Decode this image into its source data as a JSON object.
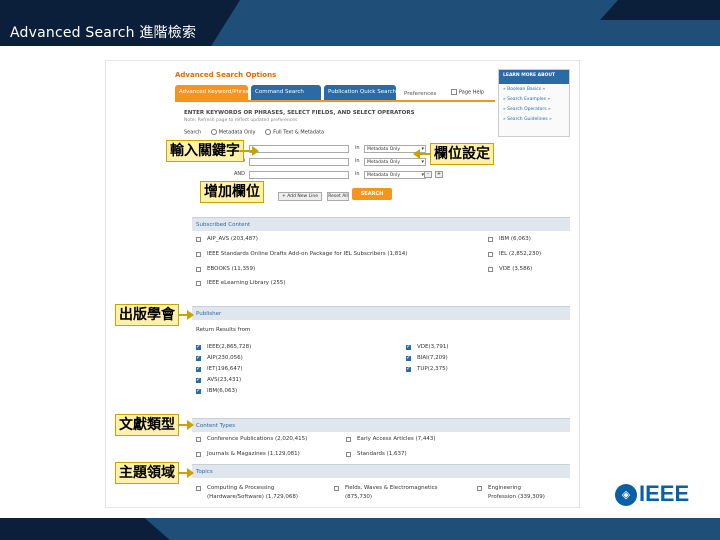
{
  "slide": {
    "title": "Advanced Search 進階檢索"
  },
  "colors": {
    "header": "#1f4e79",
    "accent_orange": "#f7941d",
    "ieee_blue": "#0b5fa5",
    "callout_bg": "#fff2a8"
  },
  "page": {
    "title": "Advanced Search Options",
    "tabs": [
      "Advanced Keyword/Phrases",
      "Command Search",
      "Publication Quick Search",
      "Preferences"
    ],
    "help_label": "Page Help",
    "instructions": "ENTER KEYWORDS OR PHRASES, SELECT FIELDS, AND SELECT OPERATORS",
    "sub_instructions": "Note: Refresh page to reflect updated preferences",
    "search_label": "Search",
    "radio_options": [
      "Metadata Only",
      "Full Text & Metadata"
    ],
    "rows": [
      {
        "op": "",
        "in_label": "in",
        "field": "Metadata Only"
      },
      {
        "op": "AND",
        "in_label": "in",
        "field": "Metadata Only"
      },
      {
        "op": "AND",
        "in_label": "in",
        "field": "Metadata Only"
      }
    ],
    "add_row_label": "+ Add New Line",
    "reset_label": "Reset All",
    "search_button": "SEARCH",
    "sidebar": {
      "title": "LEARN MORE ABOUT",
      "links": [
        "» Boolean Basics »",
        "» Search Examples »",
        "» Search Operators »",
        "» Search Guidelines »"
      ]
    },
    "subscribed": {
      "header": "Subscribed Content",
      "left": [
        "AIP_AVS (203,487)",
        "IEEE Standards Online Drafts Add-on Package for IEL Subscribers (1,814)",
        "EBOOKS (11,359)",
        "IEEE eLearning Library (255)"
      ],
      "right": [
        "IBM (6,063)",
        "IEL (2,852,230)",
        "VDE (3,586)"
      ]
    },
    "publisher": {
      "header": "Publisher",
      "return_label": "Return Results from",
      "left": [
        "IEEE(2,865,728)",
        "AIP(230,056)",
        "IET(196,647)",
        "AVS(23,431)",
        "IBM(6,063)"
      ],
      "right": [
        "VDE(3,791)",
        "BIAI(7,209)",
        "TUP(2,375)"
      ]
    },
    "content_types": {
      "header": "Content Types",
      "items": [
        "Conference Publications (2,020,415)",
        "Early Access Articles (7,443)",
        "Journals & Magazines (1,129,081)",
        "Standards (1,637)"
      ]
    },
    "topics": {
      "header": "Topics",
      "items": [
        {
          "l1": "Computing & Processing",
          "l2": "(Hardware/Software) (1,729,068)"
        },
        {
          "l1": "Fields, Waves & Electromagnetics",
          "l2": "(875,730)"
        },
        {
          "l1": "Engineering",
          "l2": "Profession (339,309)"
        }
      ]
    }
  },
  "callouts": {
    "keyword": "輸入關鍵字",
    "field_setting": "欄位設定",
    "add_field": "增加欄位",
    "publisher": "出版學會",
    "doc_type": "文獻類型",
    "topic_area": "主題領域"
  },
  "logo": {
    "text": "IEEE",
    "symbol": "IEEE-diamond-icon"
  }
}
